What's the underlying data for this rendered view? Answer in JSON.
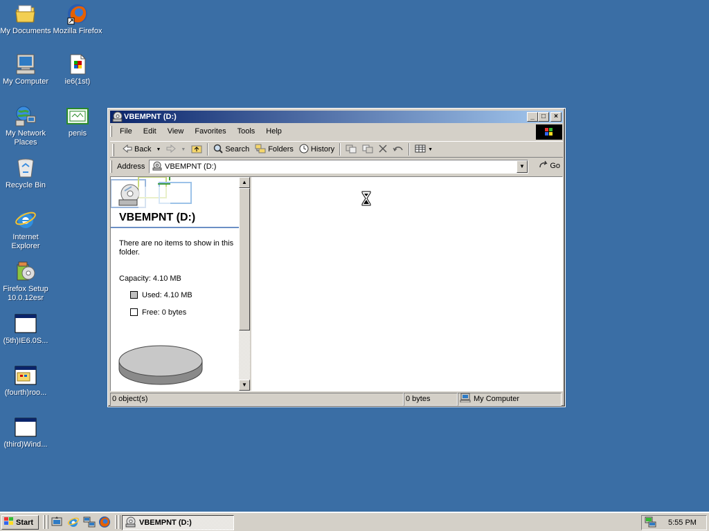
{
  "desktop": {
    "icons": [
      {
        "label": "My Documents",
        "icon": "folder-documents-icon"
      },
      {
        "label": "Mozilla Firefox",
        "icon": "firefox-icon"
      },
      {
        "label": "My Computer",
        "icon": "computer-icon"
      },
      {
        "label": "ie6(1st)",
        "icon": "file-icon"
      },
      {
        "label": "My Network Places",
        "icon": "network-icon"
      },
      {
        "label": "penis",
        "icon": "image-icon"
      },
      {
        "label": "Recycle Bin",
        "icon": "recycle-bin-icon"
      },
      {
        "label": "Internet Explorer",
        "icon": "ie-icon"
      },
      {
        "label": "Firefox Setup 10.0.12esr",
        "icon": "installer-icon"
      },
      {
        "label": "(5th)IE6.0S...",
        "icon": "window-icon"
      },
      {
        "label": "(fourth)roo...",
        "icon": "window-icon"
      },
      {
        "label": "(third)Wind...",
        "icon": "window-icon"
      }
    ]
  },
  "window": {
    "title": "VBEMPNT (D:)",
    "menu": [
      "File",
      "Edit",
      "View",
      "Favorites",
      "Tools",
      "Help"
    ],
    "toolbar": {
      "back": "Back",
      "search": "Search",
      "folders": "Folders",
      "history": "History"
    },
    "address": {
      "label": "Address",
      "value": "VBEMPNT (D:)",
      "go": "Go"
    },
    "left_pane": {
      "title": "VBEMPNT (D:)",
      "empty_message": "There are no items to show in this folder.",
      "capacity": "Capacity: 4.10 MB",
      "used": "Used: 4.10 MB",
      "free": "Free: 0 bytes"
    },
    "status": {
      "objects": "0 object(s)",
      "size": "0 bytes",
      "zone": "My Computer"
    }
  },
  "taskbar": {
    "start": "Start",
    "task": "VBEMPNT (D:)",
    "clock": "5:55 PM"
  }
}
